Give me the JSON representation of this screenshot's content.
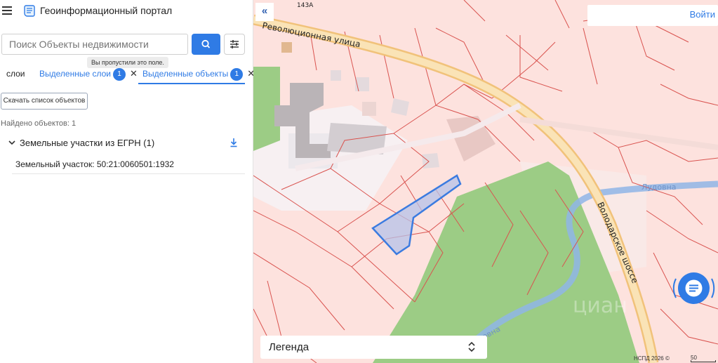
{
  "app": {
    "title": "Геоинформационный портал"
  },
  "search": {
    "placeholder": "Поиск Объекты недвижимости",
    "tooltip": "Вы пропустили это поле."
  },
  "tabs": [
    {
      "label": "слои"
    },
    {
      "label": "Выделенные слои",
      "count": "1"
    },
    {
      "label": "Выделенные объекты",
      "count": "1"
    }
  ],
  "actions": {
    "download_list": "Скачать список объектов"
  },
  "results": {
    "found_text": "Найдено объектов: 1",
    "group_title": "Земельные участки из ЕГРН (1)",
    "items": [
      {
        "label": "Земельный участок: 50:21:0060501:1932"
      }
    ]
  },
  "map": {
    "login_label": "Войти",
    "legend_label": "Легенда",
    "streets": {
      "revolution": "Революционная улица",
      "volodarskoe": "Володарское шоссе",
      "river": "Лудовна",
      "river2": "довна"
    },
    "house_number": "143А",
    "copyright": "НСПД 2026 ©",
    "scale": "50",
    "watermark": "циан"
  },
  "colors": {
    "accent": "#2f7be5",
    "parcel_line": "#d9534f",
    "selected_parcel": "#3b7be0",
    "road": "#f1c27a",
    "forest": "#9ccc85",
    "river": "#8fb5e6"
  }
}
